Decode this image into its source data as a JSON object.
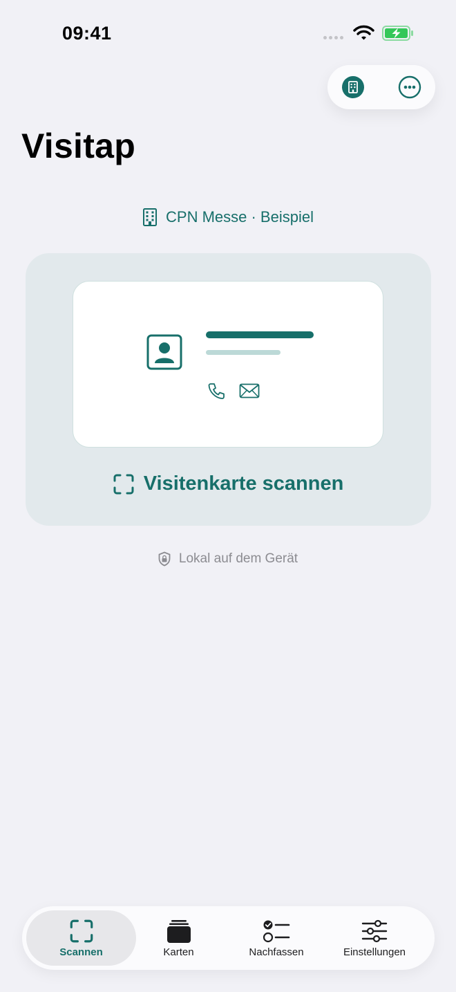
{
  "status_bar": {
    "time": "09:41",
    "icons": [
      "cellular-signal-icon",
      "wifi-icon",
      "battery-charging-icon"
    ]
  },
  "top_actions": {
    "icons": [
      "building-icon",
      "more-icon"
    ]
  },
  "header": {
    "title": "Visitap"
  },
  "workspace": {
    "label": "CPN Messe · Beispiel",
    "icon": "building-icon"
  },
  "scan_card": {
    "cta_label": "Visitenkarte scannen",
    "cta_icon": "scan-frame-icon",
    "illustration_icons": [
      "contact-avatar-icon",
      "phone-icon",
      "mail-icon"
    ]
  },
  "privacy": {
    "text": "Lokal auf dem Gerät",
    "icon": "shield-lock-icon"
  },
  "tab_bar": {
    "tabs": [
      {
        "label": "Scannen",
        "icon": "scan-frame-icon",
        "active": true
      },
      {
        "label": "Karten",
        "icon": "cards-stack-icon",
        "active": false
      },
      {
        "label": "Nachfassen",
        "icon": "checklist-icon",
        "active": false
      },
      {
        "label": "Einstellungen",
        "icon": "sliders-icon",
        "active": false
      }
    ]
  },
  "colors": {
    "accent": "#176f6a",
    "background": "#f1f1f6",
    "card_background": "#e2e9ec",
    "battery_green": "#34c759",
    "muted_text": "#8c8c91"
  }
}
